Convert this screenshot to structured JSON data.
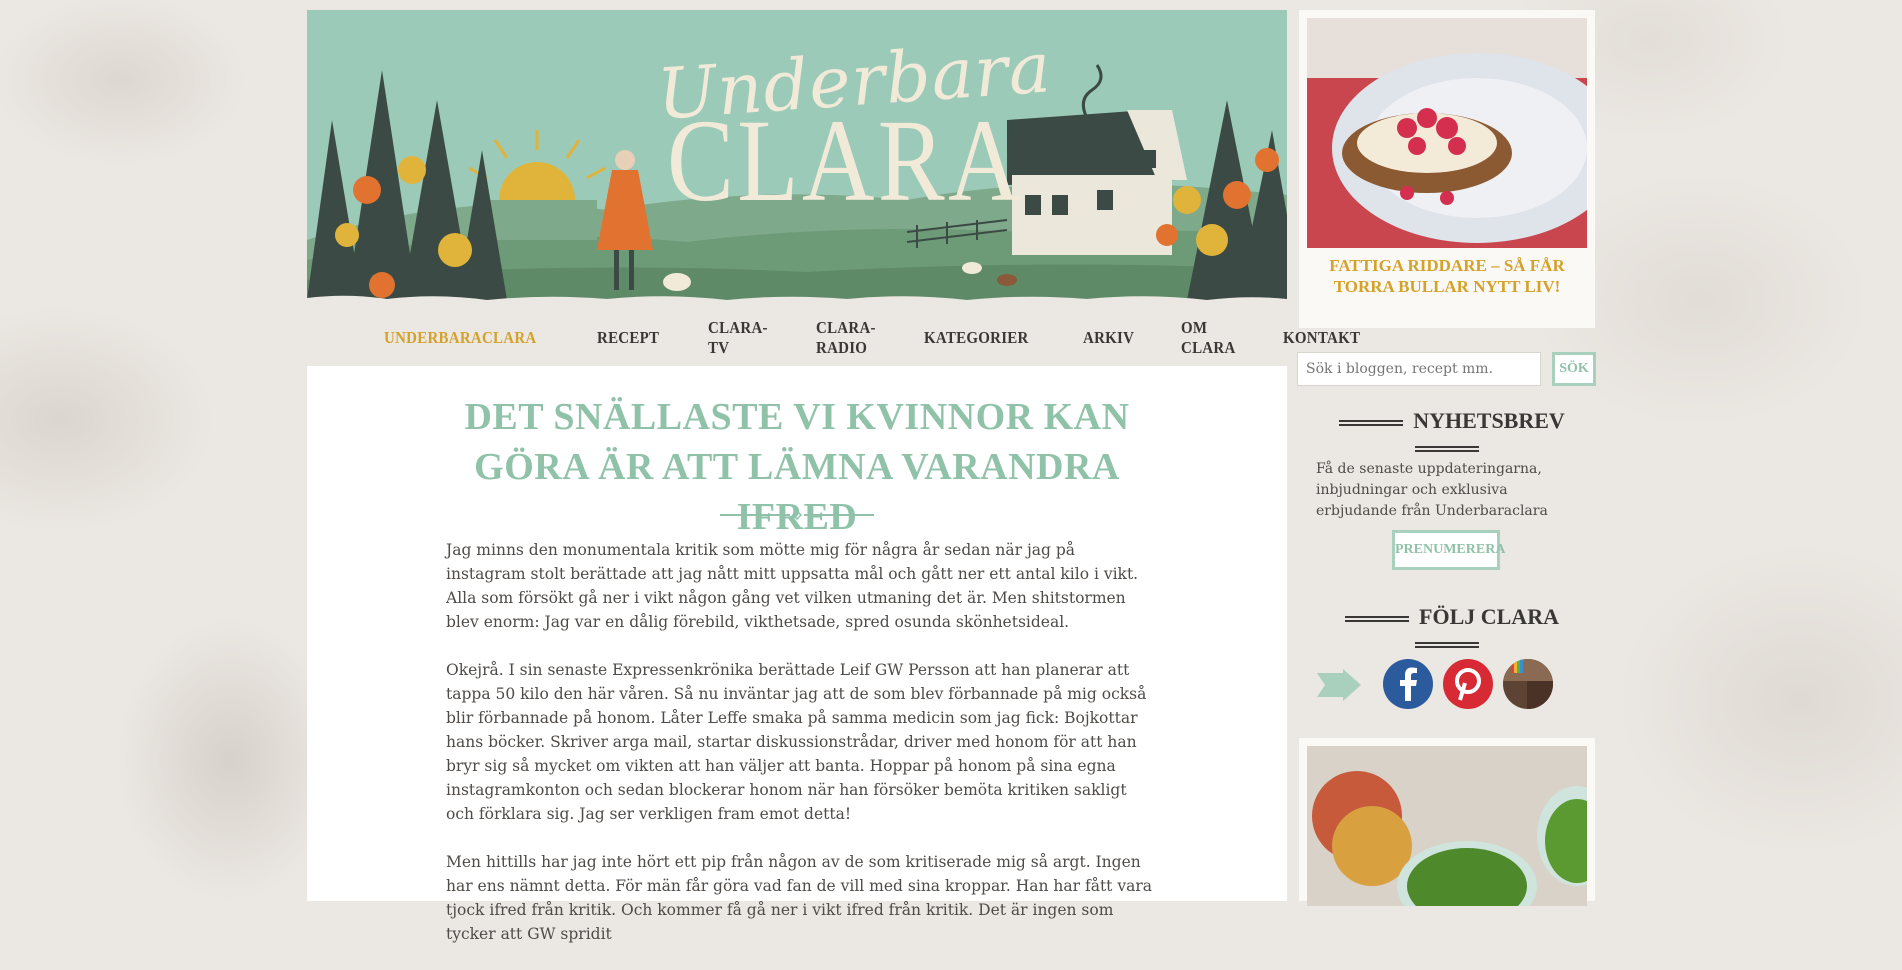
{
  "header": {
    "script_title": "Underbara",
    "main_title": "CLARA"
  },
  "nav": {
    "items": [
      "UNDERBARACLARA",
      "RECEPT",
      "CLARA-TV",
      "CLARA-RADIO",
      "KATEGORIER",
      "ARKIV",
      "OM CLARA",
      "KONTAKT"
    ],
    "active_index": 0
  },
  "post": {
    "title": "DET SNÄLLASTE VI KVINNOR KAN GÖRA ÄR ATT LÄMNA VARANDRA IFRED",
    "paragraphs": [
      "Jag minns den monumentala kritik som mötte mig för några år sedan när jag på instagram stolt berättade att jag nått mitt uppsatta mål och gått ner ett antal kilo i vikt. Alla som försökt gå ner i vikt någon gång vet vilken utmaning det är. Men shitstormen blev enorm: Jag var en dålig förebild, vikthetsade, spred osunda skönhetsideal.",
      "Okejrå. I sin senaste Expressenkrönika berättade Leif GW Persson att han planerar att tappa 50 kilo den här våren. Så nu inväntar jag att de som blev förbannade på mig också blir förbannade på honom. Låter Leffe smaka på samma medicin som jag fick: Bojkottar hans böcker. Skriver arga mail, startar diskussionstrådar, driver med honom för att han bryr sig så mycket om vikten att han väljer att banta. Hoppar på honom på sina egna instagramkonton och sedan blockerar honom när han försöker bemöta kritiken sakligt och förklara sig. Jag ser verkligen fram emot detta!",
      "Men hittills har jag inte hört ett pip från någon av de som kritiserade mig så argt. Ingen har ens nämnt detta. För män får göra vad fan de vill med sina kroppar. Han har fått vara tjock ifred från kritik. Och kommer få gå ner i vikt ifred från kritik. Det är ingen som tycker att GW spridit"
    ]
  },
  "sidebar": {
    "featured_title": "FATTIGA RIDDARE – SÅ FÅR TORRA BULLAR NYTT LIV!",
    "search_placeholder": "Sök i bloggen, recept mm.",
    "search_button": "SÖK",
    "newsletter_heading": "NYHETSBREV",
    "newsletter_text": "Få de senaste uppdateringarna, inbjudningar och exklusiva erbjudande från Underbaraclara",
    "subscribe_button": "PRENUMERERA",
    "follow_heading": "FÖLJ CLARA",
    "social": [
      "arrow-icon",
      "facebook-icon",
      "pinterest-icon",
      "instagram-icon"
    ]
  },
  "colors": {
    "accent_gold": "#d4a22a",
    "accent_mint": "#8fc2a8",
    "banner_sky": "#9ccab9",
    "facebook": "#2b5a9d",
    "pinterest": "#d72a35",
    "instagram": "#5d4333"
  }
}
